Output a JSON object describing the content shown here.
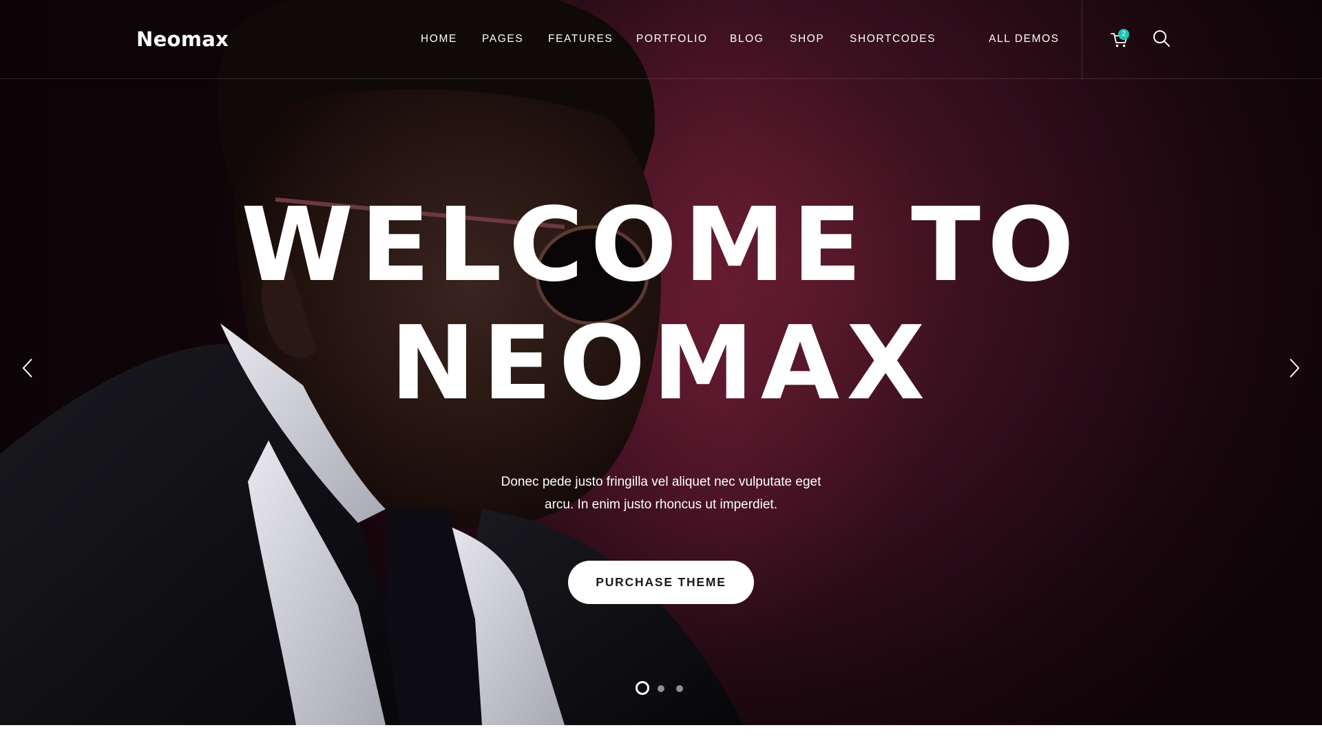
{
  "brand": {
    "name": "Neomax"
  },
  "nav": {
    "items": [
      {
        "label": "HOME"
      },
      {
        "label": "PAGES"
      },
      {
        "label": "FEATURES"
      },
      {
        "label": "PORTFOLIO"
      },
      {
        "label": "BLOG"
      },
      {
        "label": "SHOP"
      },
      {
        "label": "SHORTCODES"
      },
      {
        "label": "ALL DEMOS"
      }
    ]
  },
  "header_actions": {
    "cart_icon": "cart-icon",
    "cart_count": "2",
    "search_icon": "search-icon"
  },
  "hero": {
    "headline_line1": "WELCOME TO",
    "headline_line2": "NEOMAX",
    "subtext_line1": "Donec pede justo fringilla vel aliquet nec vulputate eget",
    "subtext_line2": "arcu. In enim justo rhoncus ut imperdiet.",
    "cta_label": "PURCHASE THEME",
    "prev_icon": "chevron-left-icon",
    "next_icon": "chevron-right-icon"
  },
  "slider": {
    "slide_count": 3,
    "active_slide": 1
  },
  "colors": {
    "accent": "#1fc6b6",
    "hero_background": "#3b1020",
    "text": "#ffffff",
    "button_background": "#ffffff",
    "button_text": "#1a1a1a"
  }
}
